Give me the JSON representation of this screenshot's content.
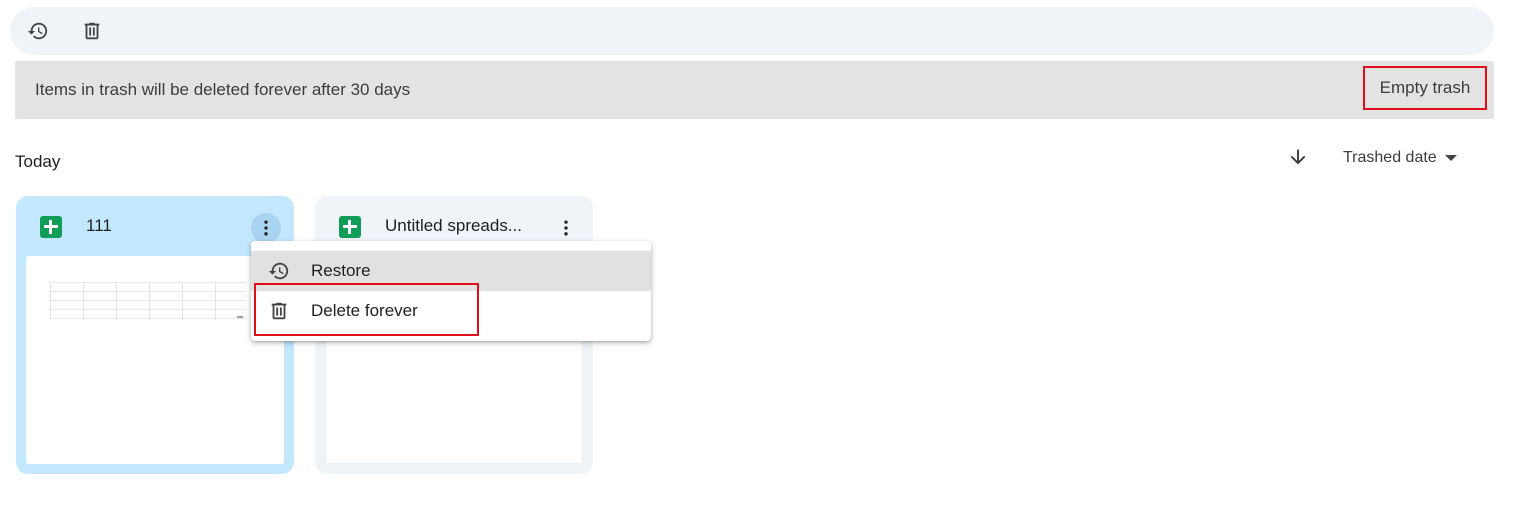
{
  "toolbar": {
    "restore_icon": "restore-history-icon",
    "delete_icon": "trash-icon"
  },
  "banner": {
    "message": "Items in trash will be deleted forever after 30 days",
    "empty_trash_label": "Empty trash"
  },
  "section": {
    "title": "Today",
    "sort_direction_icon": "arrow-down-icon",
    "sort_label": "Trashed date"
  },
  "files": [
    {
      "name": "111",
      "icon": "google-sheets-icon",
      "selected": true
    },
    {
      "name": "Untitled spreads...",
      "icon": "google-sheets-icon",
      "selected": false
    }
  ],
  "context_menu": {
    "items": [
      {
        "label": "Restore",
        "icon": "restore-history-icon"
      },
      {
        "label": "Delete forever",
        "icon": "trash-icon"
      }
    ]
  },
  "colors": {
    "accent_highlight": "#e0101a",
    "selected_card": "#c2e7ff",
    "sheets_green": "#0f9d58"
  }
}
